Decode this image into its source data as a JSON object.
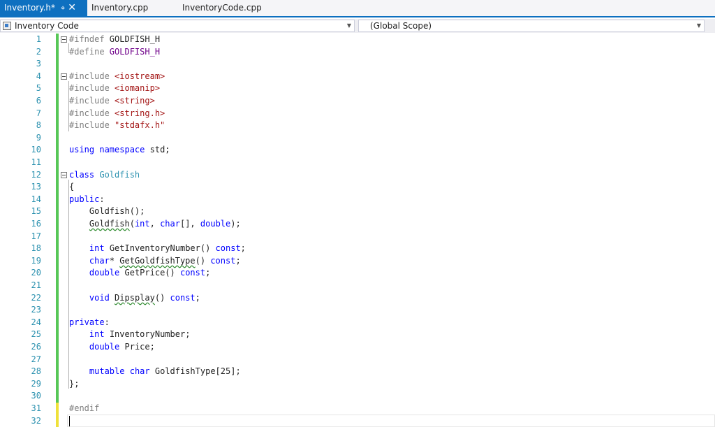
{
  "tabs": [
    {
      "label": "Inventory.h*",
      "active": true,
      "pin_icon": "pin-icon",
      "close_icon": "close-icon"
    },
    {
      "label": "Inventory.cpp",
      "active": false
    },
    {
      "label": "InventoryCode.cpp",
      "active": false
    }
  ],
  "nav": {
    "project": "Inventory Code",
    "scope": "(Global Scope)"
  },
  "editor": {
    "lines": [
      {
        "n": "1"
      },
      {
        "n": "2"
      },
      {
        "n": "3"
      },
      {
        "n": "4"
      },
      {
        "n": "5"
      },
      {
        "n": "6"
      },
      {
        "n": "7"
      },
      {
        "n": "8"
      },
      {
        "n": "9"
      },
      {
        "n": "10"
      },
      {
        "n": "11"
      },
      {
        "n": "12"
      },
      {
        "n": "13"
      },
      {
        "n": "14"
      },
      {
        "n": "15"
      },
      {
        "n": "16"
      },
      {
        "n": "17"
      },
      {
        "n": "18"
      },
      {
        "n": "19"
      },
      {
        "n": "20"
      },
      {
        "n": "21"
      },
      {
        "n": "22"
      },
      {
        "n": "23"
      },
      {
        "n": "24"
      },
      {
        "n": "25"
      },
      {
        "n": "26"
      },
      {
        "n": "27"
      },
      {
        "n": "28"
      },
      {
        "n": "29"
      },
      {
        "n": "30"
      },
      {
        "n": "31"
      },
      {
        "n": "32"
      }
    ],
    "code": {
      "l1a": "#ifndef ",
      "l1b": "GOLDFISH_H",
      "l2a": "#define ",
      "l2b": "GOLDFISH_H",
      "l4a": "#include ",
      "l4b": "<iostream>",
      "l5a": "#include ",
      "l5b": "<iomanip>",
      "l6a": "#include ",
      "l6b": "<string>",
      "l7a": "#include ",
      "l7b": "<string.h>",
      "l8a": "#include ",
      "l8b": "\"stdafx.h\"",
      "l10a": "using",
      "l10b": " ",
      "l10c": "namespace",
      "l10d": " std;",
      "l12a": "class",
      "l12b": " ",
      "l12c": "Goldfish",
      "l13": "{",
      "l14a": "public",
      "l14b": ":",
      "l15": "    Goldfish();",
      "l16a": "    ",
      "l16b": "Goldfish",
      "l16c": "(",
      "l16d": "int",
      "l16e": ", ",
      "l16f": "char",
      "l16g": "[], ",
      "l16h": "double",
      "l16i": ");",
      "l18a": "    ",
      "l18b": "int",
      "l18c": " GetInventoryNumber() ",
      "l18d": "const",
      "l18e": ";",
      "l19a": "    ",
      "l19b": "char",
      "l19c": "* ",
      "l19d": "GetGoldfishType",
      "l19e": "() ",
      "l19f": "const",
      "l19g": ";",
      "l20a": "    ",
      "l20b": "double",
      "l20c": " GetPrice() ",
      "l20d": "const",
      "l20e": ";",
      "l22a": "    ",
      "l22b": "void",
      "l22c": " ",
      "l22d": "Dipsplay",
      "l22e": "() ",
      "l22f": "const",
      "l22g": ";",
      "l24a": "private",
      "l24b": ":",
      "l25a": "    ",
      "l25b": "int",
      "l25c": " InventoryNumber;",
      "l26a": "    ",
      "l26b": "double",
      "l26c": " Price;",
      "l28a": "    ",
      "l28b": "mutable",
      "l28c": " ",
      "l28d": "char",
      "l28e": " GoldfishType[25];",
      "l29": "};",
      "l31": "#endif"
    }
  },
  "colors": {
    "accent": "#0e70c0",
    "keyword": "#0000ff",
    "string": "#a31515",
    "type": "#2b91af",
    "macro": "#6f008a",
    "preprocessor": "#808080",
    "line_number": "#2b91af",
    "change_saved": "#57c757",
    "change_unsaved": "#efe13a"
  }
}
